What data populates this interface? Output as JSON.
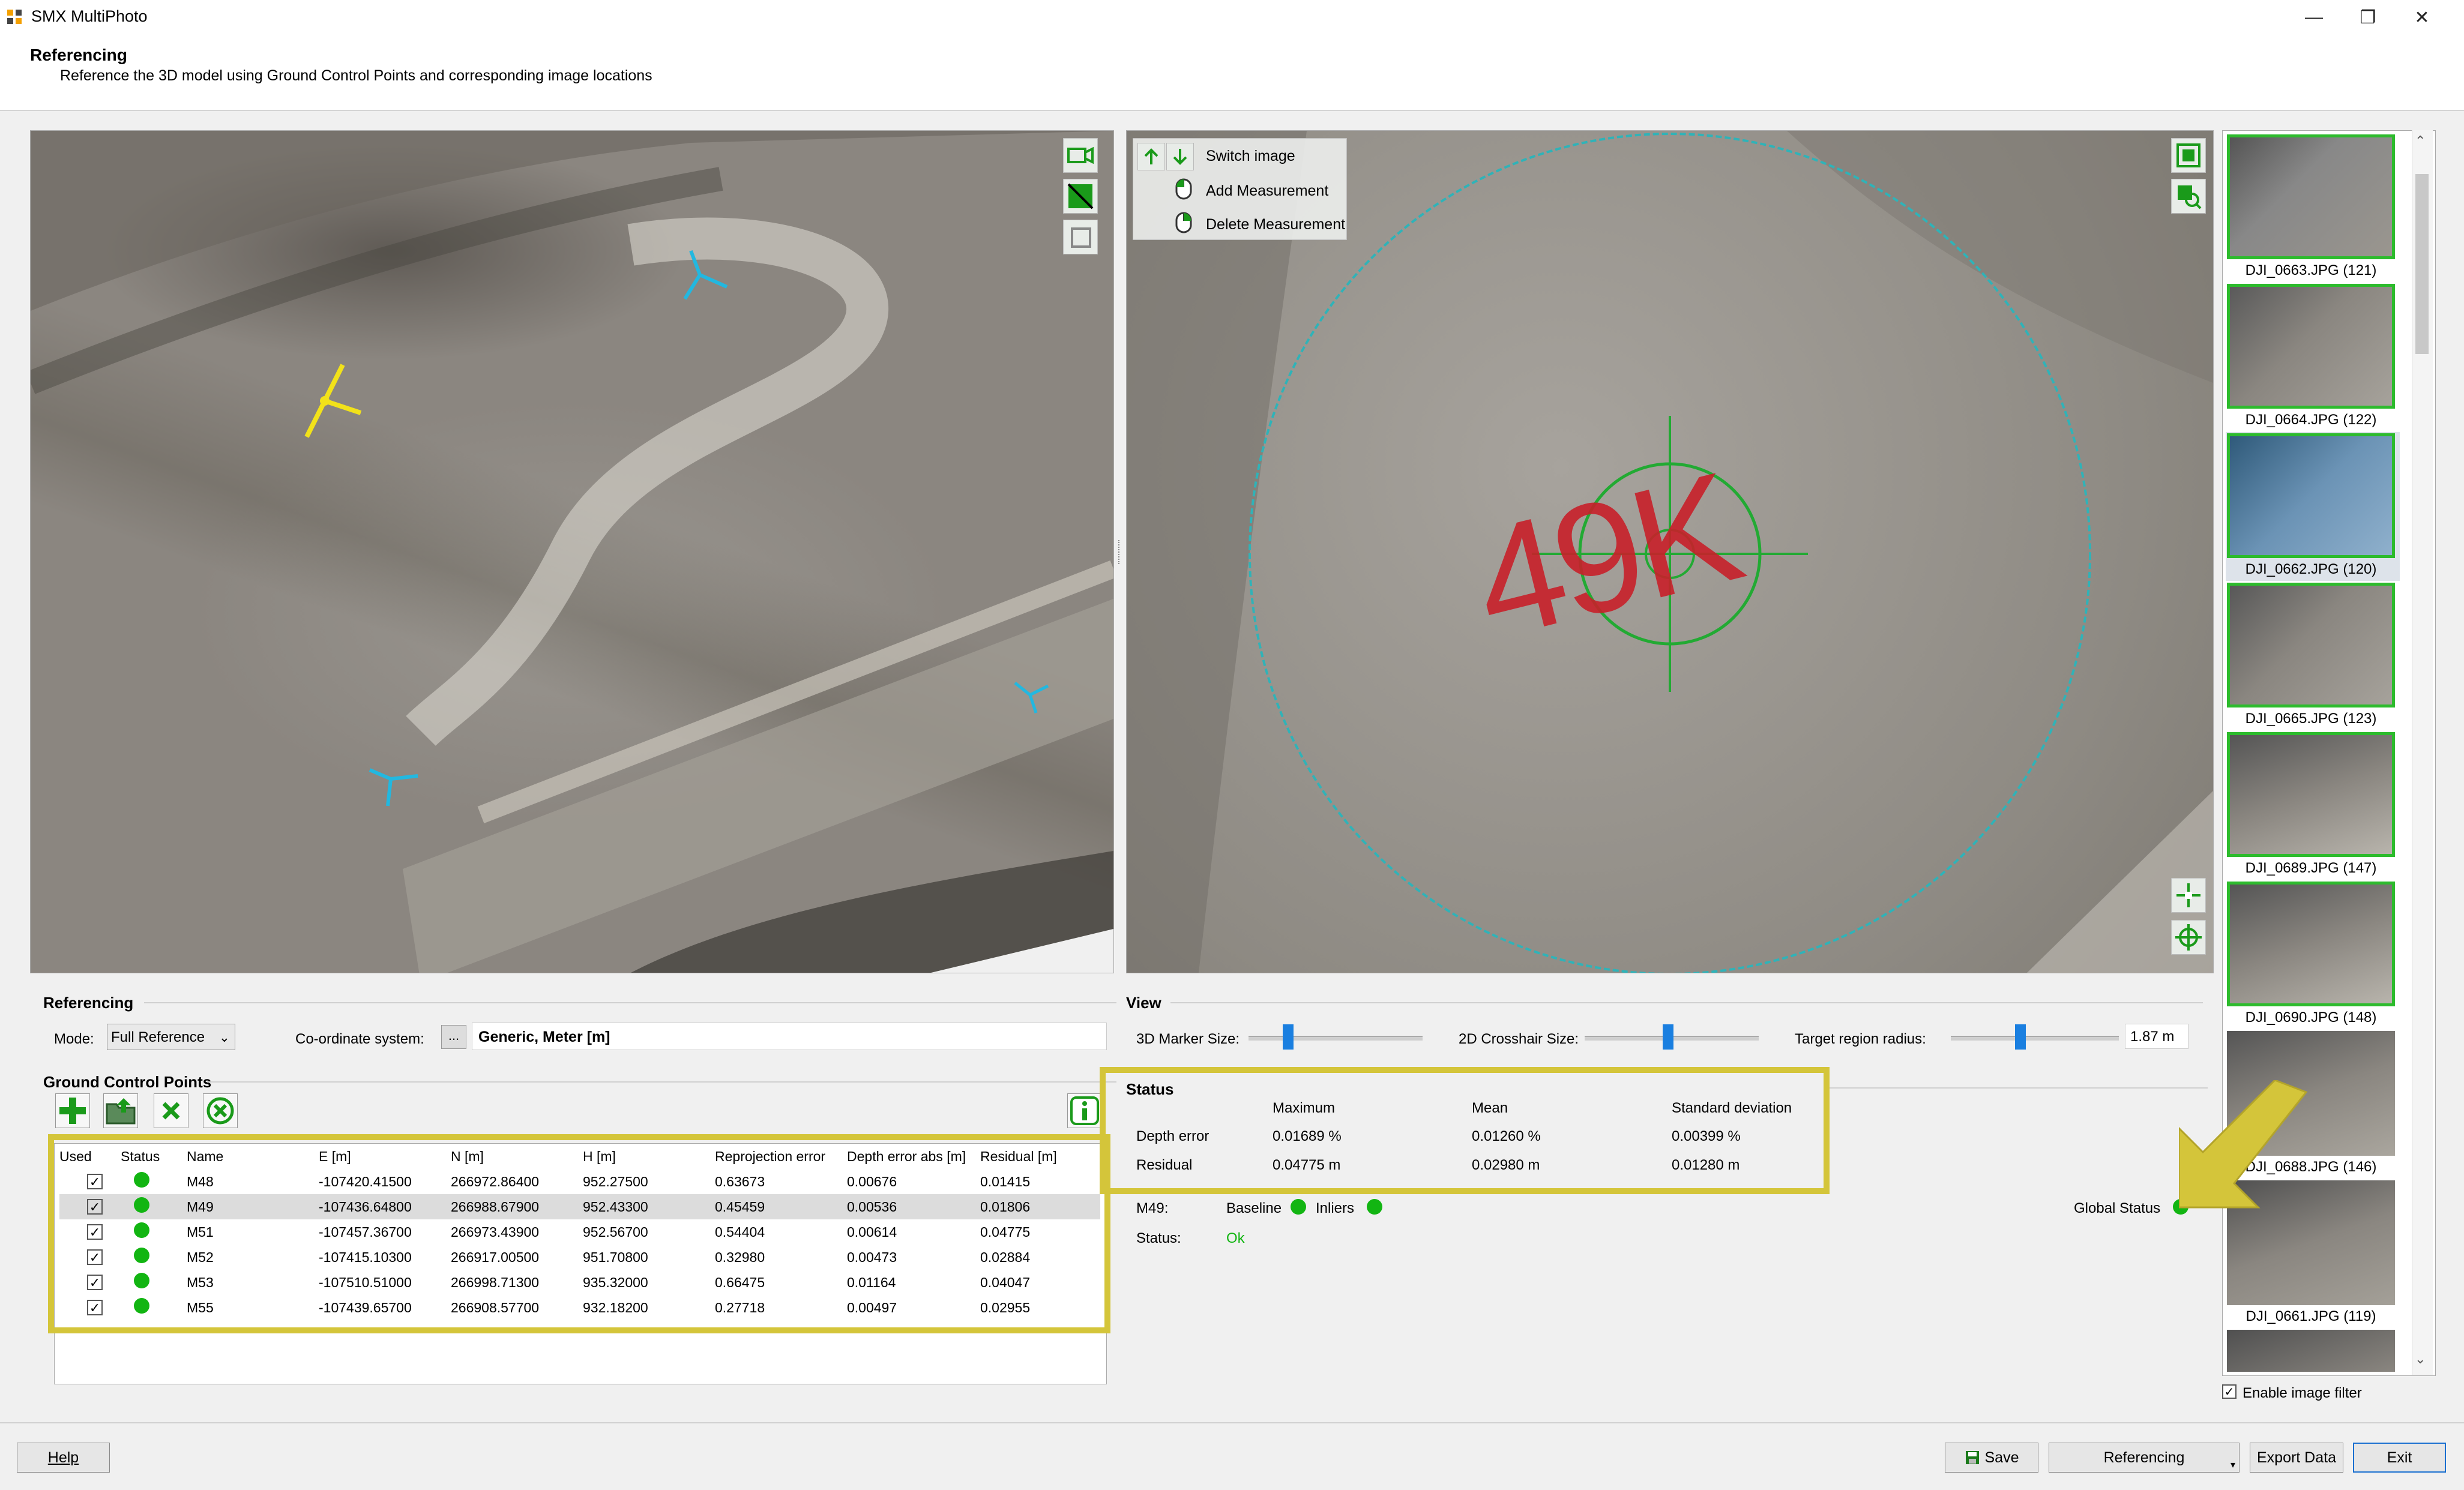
{
  "window": {
    "title": "SMX MultiPhoto"
  },
  "header": {
    "title": "Referencing",
    "subtitle": "Reference the 3D model using Ground Control Points and corresponding image locations"
  },
  "image_view": {
    "hint_switch": "Switch image",
    "hint_add": "Add Measurement",
    "hint_delete": "Delete Measurement",
    "marker_text": "49K"
  },
  "thumbnails": [
    {
      "label": "DJI_0663.JPG (121)"
    },
    {
      "label": "DJI_0664.JPG (122)"
    },
    {
      "label": "DJI_0662.JPG (120)"
    },
    {
      "label": "DJI_0665.JPG (123)"
    },
    {
      "label": "DJI_0689.JPG (147)"
    },
    {
      "label": "DJI_0690.JPG (148)"
    },
    {
      "label": "DJI_0688.JPG (146)"
    },
    {
      "label": "DJI_0661.JPG (119)"
    }
  ],
  "referencing": {
    "section_title": "Referencing",
    "mode_label": "Mode:",
    "mode_value": "Full Reference",
    "coord_label": "Co-ordinate system:",
    "coord_button": "...",
    "coord_value": "Generic, Meter [m]"
  },
  "view": {
    "section_title": "View",
    "marker_size_label": "3D Marker Size:",
    "crosshair_label": "2D Crosshair Size:",
    "target_label": "Target region radius:",
    "target_value": "1.87 m"
  },
  "gcp": {
    "section_title": "Ground Control Points",
    "columns": [
      "Used",
      "Status",
      "Name",
      "E [m]",
      "N [m]",
      "H [m]",
      "Reprojection error",
      "Depth error abs [m]",
      "Residual [m]"
    ],
    "rows": [
      {
        "name": "M48",
        "e": "-107420.41500",
        "n": "266972.86400",
        "h": "952.27500",
        "reproj": "0.63673",
        "depth": "0.00676",
        "resid": "0.01415"
      },
      {
        "name": "M49",
        "e": "-107436.64800",
        "n": "266988.67900",
        "h": "952.43300",
        "reproj": "0.45459",
        "depth": "0.00536",
        "resid": "0.01806"
      },
      {
        "name": "M51",
        "e": "-107457.36700",
        "n": "266973.43900",
        "h": "952.56700",
        "reproj": "0.54404",
        "depth": "0.00614",
        "resid": "0.04775"
      },
      {
        "name": "M52",
        "e": "-107415.10300",
        "n": "266917.00500",
        "h": "951.70800",
        "reproj": "0.32980",
        "depth": "0.00473",
        "resid": "0.02884"
      },
      {
        "name": "M53",
        "e": "-107510.51000",
        "n": "266998.71300",
        "h": "935.32000",
        "reproj": "0.66475",
        "depth": "0.01164",
        "resid": "0.04047"
      },
      {
        "name": "M55",
        "e": "-107439.65700",
        "n": "266908.57700",
        "h": "932.18200",
        "reproj": "0.27718",
        "depth": "0.00497",
        "resid": "0.02955"
      }
    ]
  },
  "status": {
    "section_title": "Status",
    "col_max": "Maximum",
    "col_mean": "Mean",
    "col_std": "Standard deviation",
    "depth_label": "Depth error",
    "depth_max": "0.01689 %",
    "depth_mean": "0.01260 %",
    "depth_std": "0.00399 %",
    "resid_label": "Residual",
    "resid_max": "0.04775 m",
    "resid_mean": "0.02980 m",
    "resid_std": "0.01280 m",
    "point_label": "M49:",
    "baseline_label": "Baseline",
    "inliers_label": "Inliers",
    "global_label": "Global Status",
    "status_label": "Status:",
    "status_value": "Ok"
  },
  "filter": {
    "label": "Enable image filter"
  },
  "footer": {
    "help": "Help",
    "save": "Save",
    "referencing": "Referencing",
    "export": "Export Data",
    "exit": "Exit"
  },
  "colors": {
    "accent_green": "#12b512",
    "highlight": "#d4c53a",
    "arrow": "#d4c53a",
    "marker_red": "#c8202a"
  }
}
